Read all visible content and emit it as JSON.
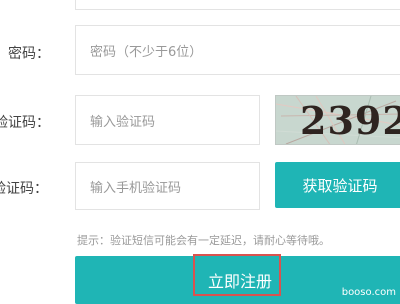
{
  "form": {
    "password": {
      "label": "密码：",
      "placeholder": "密码（不少于6位）"
    },
    "captcha": {
      "label": "验证码：",
      "placeholder": "输入验证码",
      "image_text": "2392"
    },
    "sms_code": {
      "label": "验证码：",
      "placeholder": "输入手机验证码",
      "get_code_button": "获取验证码"
    },
    "hint": "提示：验证短信可能会有一定延迟，请耐心等待哦。",
    "register_button": "立即注册"
  },
  "watermark": "booso.com",
  "colors": {
    "accent": "#1fb5b5",
    "highlight_outline": "#d9534f"
  }
}
